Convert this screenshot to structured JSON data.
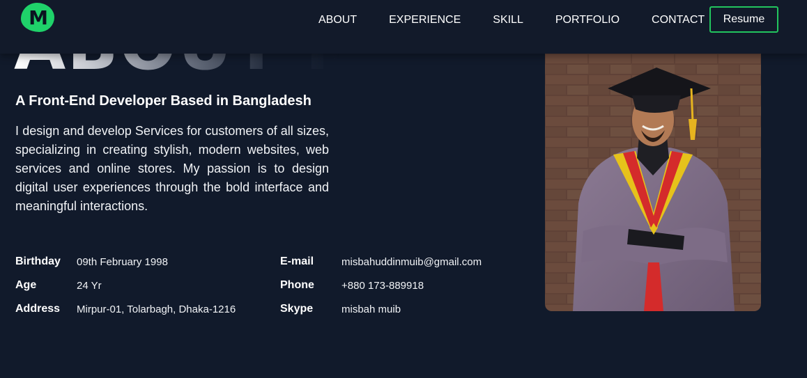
{
  "nav": {
    "logo_letter": "M",
    "links": [
      "ABOUT",
      "EXPERIENCE",
      "SKILL",
      "PORTFOLIO",
      "CONTACT"
    ],
    "resume_label": "Resume",
    "accent_color": "#22c55e"
  },
  "hero": {
    "big_heading": "ABOUT ME",
    "subtitle": "A Front-End Developer Based in Bangladesh",
    "intro": "I design and develop Services for customers of all sizes, specializing in creating stylish, modern websites, web services and online stores. My passion is to design digital user experiences through the bold interface and meaningful interactions."
  },
  "info": {
    "left": [
      {
        "label": "Birthday",
        "value": "09th February 1998"
      },
      {
        "label": "Age",
        "value": "24 Yr"
      },
      {
        "label": "Address",
        "value": "Mirpur-01, Tolarbagh, Dhaka-1216"
      }
    ],
    "right": [
      {
        "label": "E-mail",
        "value": "misbahuddinmuib@gmail.com"
      },
      {
        "label": "Phone",
        "value": "+880 173-889918"
      },
      {
        "label": "Skype",
        "value": "misbah muib"
      }
    ]
  },
  "photo": {
    "icon": "profile-photo-graduate"
  }
}
